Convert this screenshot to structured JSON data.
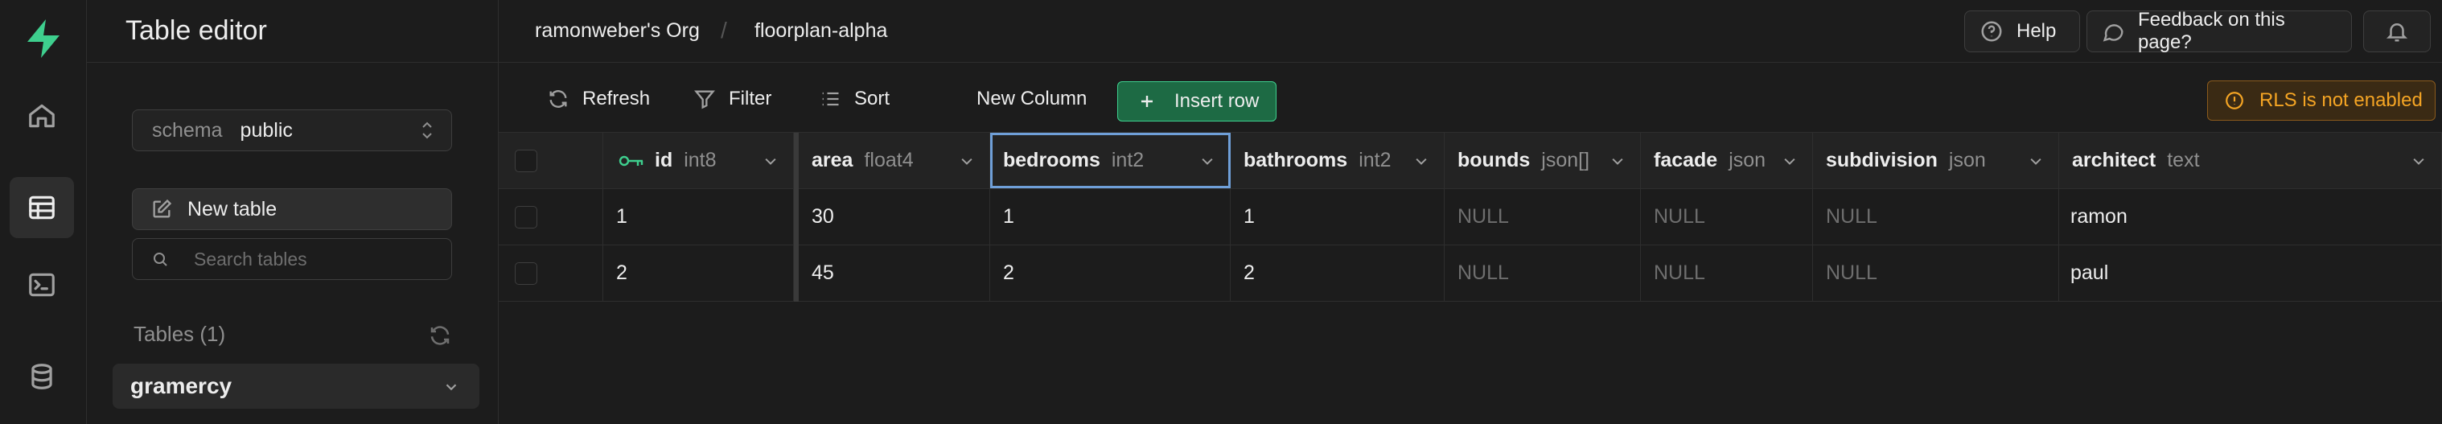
{
  "sidebar": {
    "title": "Table editor",
    "schema": {
      "label": "schema",
      "value": "public"
    },
    "new_table_label": "New table",
    "search_placeholder": "Search tables",
    "tables_header": "Tables (1)",
    "tables": [
      {
        "name": "gramercy"
      }
    ]
  },
  "breadcrumb": {
    "org": "ramonweber's Org",
    "separator": "/",
    "project": "floorplan-alpha"
  },
  "topbar": {
    "help_label": "Help",
    "feedback_label": "Feedback on this page?"
  },
  "toolbar": {
    "refresh_label": "Refresh",
    "filter_label": "Filter",
    "sort_label": "Sort",
    "new_column_label": "New Column",
    "insert_row_label": "Insert row",
    "rls_label": "RLS is not enabled"
  },
  "grid": {
    "columns": [
      {
        "name": "id",
        "type": "int8"
      },
      {
        "name": "area",
        "type": "float4"
      },
      {
        "name": "bedrooms",
        "type": "int2"
      },
      {
        "name": "bathrooms",
        "type": "int2"
      },
      {
        "name": "bounds",
        "type": "json[]"
      },
      {
        "name": "facade",
        "type": "json"
      },
      {
        "name": "subdivision",
        "type": "json"
      },
      {
        "name": "architect",
        "type": "text"
      }
    ],
    "rows": [
      [
        "1",
        "30",
        "1",
        "1",
        "NULL",
        "NULL",
        "NULL",
        "ramon"
      ],
      [
        "2",
        "45",
        "2",
        "2",
        "NULL",
        "NULL",
        "NULL",
        "paul"
      ]
    ]
  },
  "colors": {
    "accent": "#3ecf8e",
    "warning": "#f5a524",
    "selection": "#6f9fd8"
  }
}
